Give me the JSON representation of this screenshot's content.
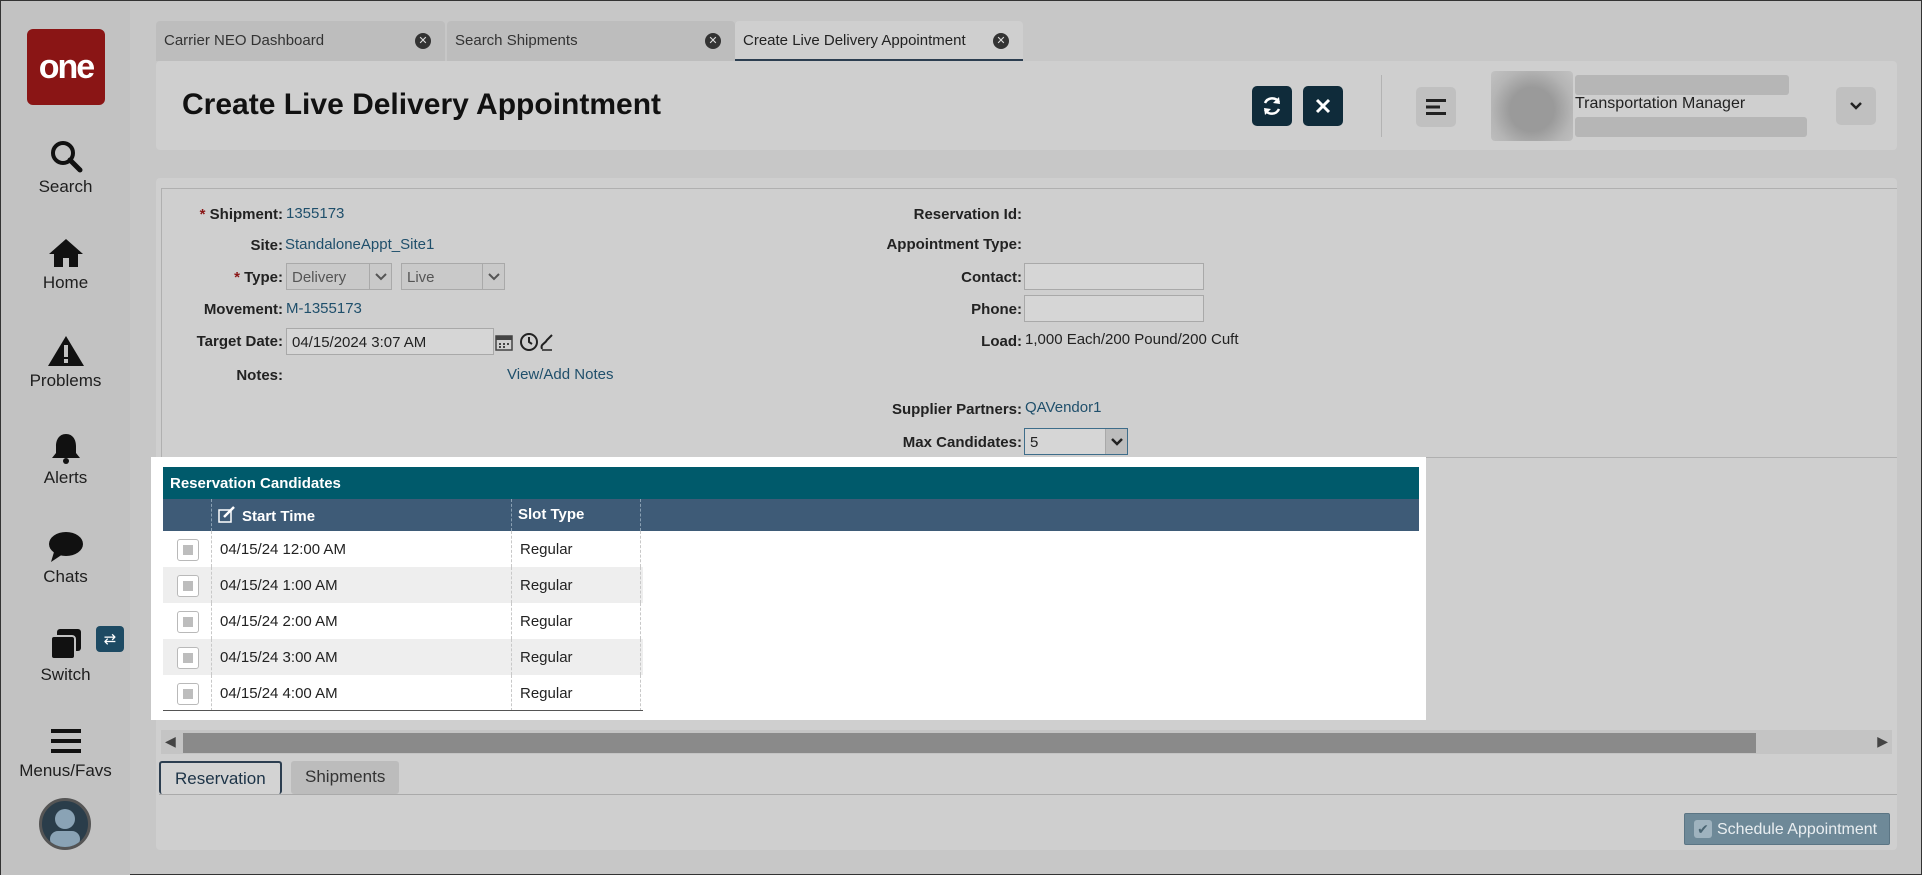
{
  "nav": {
    "logo": "one",
    "items": [
      {
        "label": "Search",
        "icon": "search-icon"
      },
      {
        "label": "Home",
        "icon": "home-icon"
      },
      {
        "label": "Problems",
        "icon": "warning-icon"
      },
      {
        "label": "Alerts",
        "icon": "bell-icon"
      },
      {
        "label": "Chats",
        "icon": "chat-icon"
      },
      {
        "label": "Switch",
        "icon": "switch-icon"
      },
      {
        "label": "Menus/Favs",
        "icon": "menu-icon"
      }
    ]
  },
  "tabs": [
    {
      "label": "Carrier NEO Dashboard",
      "active": false
    },
    {
      "label": "Search Shipments",
      "active": false
    },
    {
      "label": "Create Live Delivery Appointment",
      "active": true
    }
  ],
  "header": {
    "title": "Create Live Delivery Appointment",
    "user_role": "Transportation Manager"
  },
  "form": {
    "shipment_label": "Shipment:",
    "shipment_value": "1355173",
    "site_label": "Site:",
    "site_value": "StandaloneAppt_Site1",
    "type_label": "Type:",
    "type_value": "Delivery",
    "type_mode_value": "Live",
    "movement_label": "Movement:",
    "movement_value": "M-1355173",
    "target_date_label": "Target Date:",
    "target_date_value": "04/15/2024 3:07 AM",
    "notes_label": "Notes:",
    "notes_link": "View/Add Notes",
    "reservation_id_label": "Reservation Id:",
    "appointment_type_label": "Appointment Type:",
    "contact_label": "Contact:",
    "contact_value": "",
    "phone_label": "Phone:",
    "phone_value": "",
    "load_label": "Load:",
    "load_value": "1,000 Each/200 Pound/200 Cuft",
    "supplier_partners_label": "Supplier Partners:",
    "supplier_partners_value": "QAVendor1",
    "max_candidates_label": "Max Candidates:",
    "max_candidates_value": "5"
  },
  "grid": {
    "title": "Reservation Candidates",
    "columns": [
      "Start Time",
      "Slot Type"
    ],
    "rows": [
      {
        "start_time": "04/15/24 12:00 AM",
        "slot_type": "Regular"
      },
      {
        "start_time": "04/15/24 1:00 AM",
        "slot_type": "Regular"
      },
      {
        "start_time": "04/15/24 2:00 AM",
        "slot_type": "Regular"
      },
      {
        "start_time": "04/15/24 3:00 AM",
        "slot_type": "Regular"
      },
      {
        "start_time": "04/15/24 4:00 AM",
        "slot_type": "Regular"
      }
    ]
  },
  "bottom_tabs": [
    "Reservation",
    "Shipments"
  ],
  "actions": {
    "schedule_label": "Schedule Appointment"
  },
  "colors": {
    "accent": "#005a6b",
    "grid_header": "#3e5b77",
    "logo_bg": "#8a1515",
    "primary_button": "#0f2b3a"
  }
}
